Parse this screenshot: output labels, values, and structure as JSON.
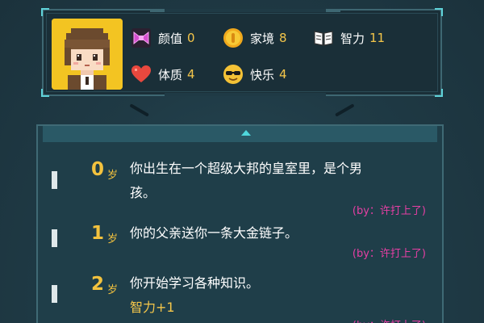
{
  "stats": [
    {
      "icon": "bow-icon",
      "label": "颜值",
      "value": "0"
    },
    {
      "icon": "coin-icon",
      "label": "家境",
      "value": "8"
    },
    {
      "icon": "book-icon",
      "label": "智力",
      "value": "11"
    },
    {
      "icon": "heart-icon",
      "label": "体质",
      "value": "4"
    },
    {
      "icon": "sunglasses-face-icon",
      "label": "快乐",
      "value": "4"
    }
  ],
  "events": [
    {
      "age": "0",
      "unit": "岁",
      "lines": [
        "你出生在一个超级大邦的皇室里，是个男",
        "孩。"
      ],
      "effect": "",
      "by": "(by：许打上了)"
    },
    {
      "age": "1",
      "unit": "岁",
      "lines": [
        "你的父亲送你一条大金链子。"
      ],
      "effect": "",
      "by": "(by：许打上了)"
    },
    {
      "age": "2",
      "unit": "岁",
      "lines": [
        "你开始学习各种知识。"
      ],
      "effect": "智力+1",
      "by": "(by：许打上了)"
    }
  ],
  "colors": {
    "accent": "#4fd7dc",
    "gold": "#f3c23e",
    "credit": "#e63fa4",
    "avatar_bg": "#f3c422"
  }
}
